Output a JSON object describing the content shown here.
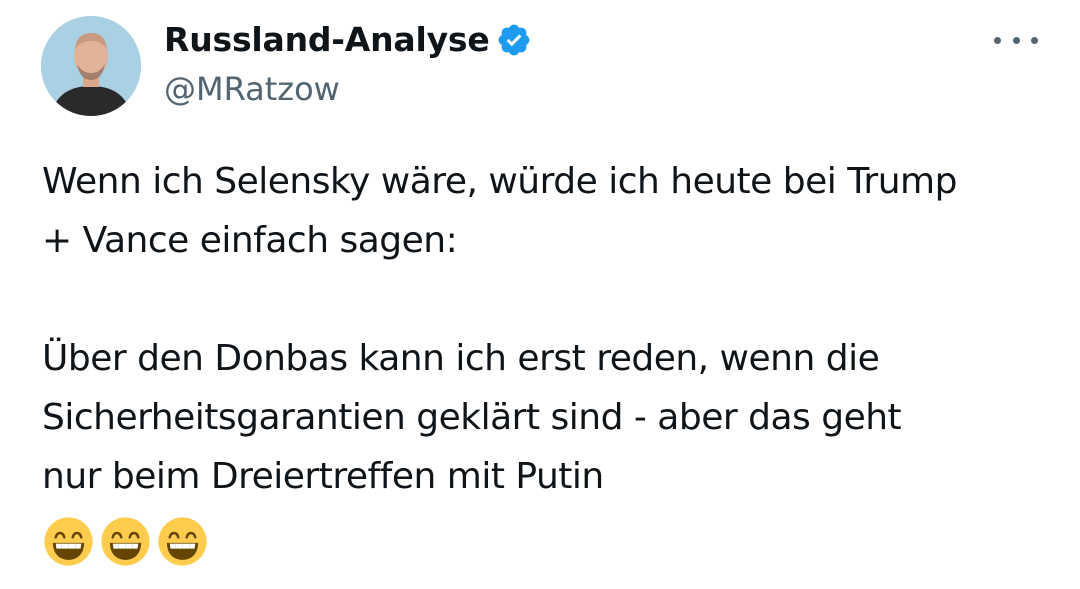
{
  "author": {
    "display_name": "Russland-Analyse",
    "handle": "@MRatzow",
    "verified": true,
    "verified_icon": "verified-badge-icon",
    "verified_color": "#1d9bf0"
  },
  "menu": {
    "icon": "more-horizontal-icon"
  },
  "tweet": {
    "line1": "Wenn ich Selensky wäre, würde ich heute bei Trump\n+ Vance einfach sagen:",
    "line2": "Über den Donbas kann ich erst reden, wenn die\nSicherheitsgarantien geklärt sind - aber das geht\nnur beim Dreiertreffen mit Putin",
    "emojis": [
      "grinning-face-with-smiling-eyes",
      "grinning-face-with-smiling-eyes",
      "grinning-face-with-smiling-eyes"
    ]
  },
  "colors": {
    "text": "#0f1419",
    "secondary": "#536471",
    "accent": "#1d9bf0"
  }
}
